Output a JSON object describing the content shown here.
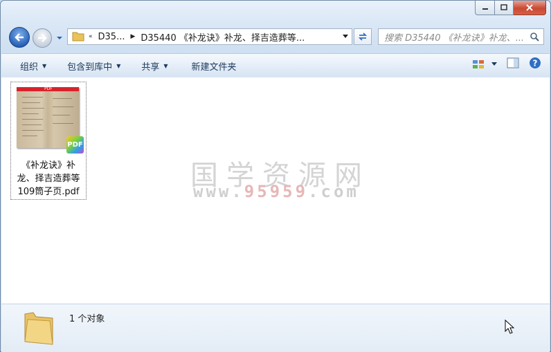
{
  "window": {
    "caption": {
      "minimize_icon": "minimize-icon",
      "maximize_icon": "maximize-icon",
      "close_icon": "close-icon"
    }
  },
  "nav": {
    "back_icon": "back-arrow-icon",
    "forward_icon": "forward-arrow-icon",
    "address": {
      "overflow_chevron": "«",
      "segments": [
        "D35...",
        "D35440 《补龙诀》补龙、择吉造葬等..."
      ]
    },
    "search_placeholder": "搜索 D35440 《补龙诀》补龙、..."
  },
  "toolbar": {
    "organize": "组织",
    "include_in_library": "包含到库中",
    "share": "共享",
    "new_folder": "新建文件夹"
  },
  "files": [
    {
      "name_lines": [
        "《补龙诀》补",
        "龙、择吉造葬等",
        "109筒子页.pdf"
      ],
      "thumb_header": "PDF",
      "badge": "PDF"
    }
  ],
  "watermark": {
    "line1": "国学资源网",
    "line2_prefix": "www.",
    "line2_highlight": "95959",
    "line2_suffix": ".com"
  },
  "details": {
    "count_text": "1 个对象"
  },
  "colors": {
    "accent": "#2a62b8",
    "close_button": "#c84a34",
    "toolbar_text": "#1e395b"
  }
}
